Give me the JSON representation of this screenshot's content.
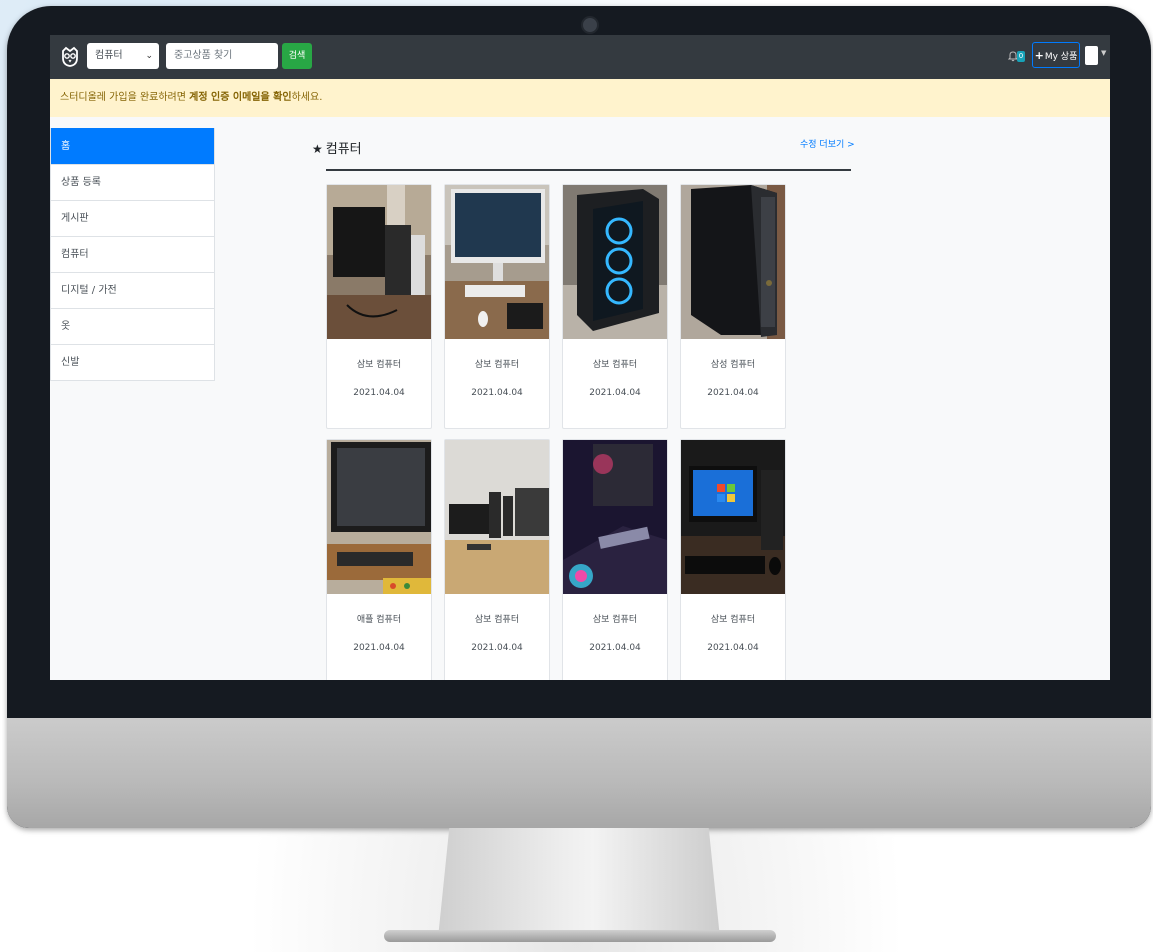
{
  "navbar": {
    "category_select": "컴퓨터",
    "search_placeholder": "중고상품 찾기",
    "search_button": "검색",
    "notification_count": "0",
    "my_products_button": "My 상품"
  },
  "alert": {
    "prefix": "스터디올레 가입을 완료하려면 ",
    "bold1": "계정 인증 이메일을 확인",
    "suffix": "하세요."
  },
  "sidebar": {
    "items": [
      {
        "label": "홈",
        "active": true
      },
      {
        "label": "상품 등록",
        "active": false
      },
      {
        "label": "게시판",
        "active": false
      },
      {
        "label": "컴퓨터",
        "active": false
      },
      {
        "label": "디지털 / 가전",
        "active": false
      },
      {
        "label": "옷",
        "active": false
      },
      {
        "label": "신발",
        "active": false
      }
    ]
  },
  "main": {
    "section_title": "컴퓨터",
    "more_link": "수정 더보기 >",
    "products": [
      {
        "name": "삼보 컴퓨터",
        "date": "2021.04.04",
        "image": "monitor-and-tower-photo"
      },
      {
        "name": "삼보 컴퓨터",
        "date": "2021.04.04",
        "image": "white-monitor-photo"
      },
      {
        "name": "삼보 컴퓨터",
        "date": "2021.04.04",
        "image": "rgb-tower-photo"
      },
      {
        "name": "삼성 컴퓨터",
        "date": "2021.04.04",
        "image": "black-tower-photo"
      },
      {
        "name": "애플 컴퓨터",
        "date": "2021.04.04",
        "image": "all-in-one-photo"
      },
      {
        "name": "삼보 컴퓨터",
        "date": "2021.04.04",
        "image": "desk-computers-photo"
      },
      {
        "name": "삼보 컴퓨터",
        "date": "2021.04.04",
        "image": "gaming-setup-photo"
      },
      {
        "name": "삼보 컴퓨터",
        "date": "2021.04.04",
        "image": "windows7-desktop-photo"
      }
    ]
  },
  "colors": {
    "navbar": "#343a40",
    "alert_bg": "#fff3cd",
    "active": "#007bff",
    "search_button": "#28a745"
  }
}
